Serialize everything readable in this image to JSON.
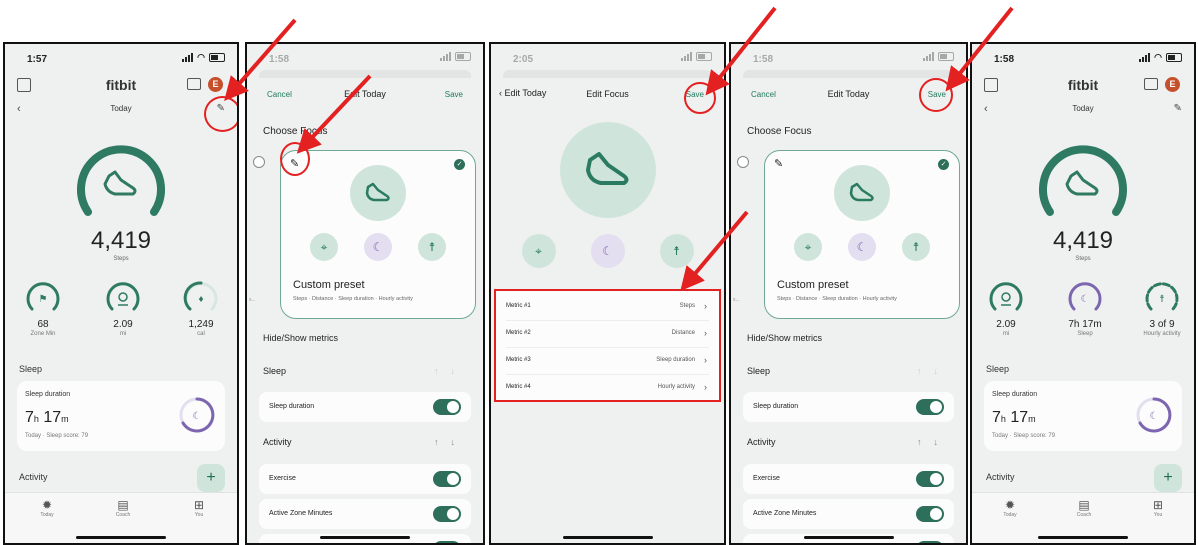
{
  "screen1": {
    "status_time": "1:57",
    "title": "fitbit",
    "avatar": "E",
    "nav_title": "Today",
    "main_value": "4,419",
    "main_label": "Steps",
    "minis": [
      {
        "value": "68",
        "label": "Zone Min"
      },
      {
        "value": "2.09",
        "label": "mi"
      },
      {
        "value": "1,249",
        "label": "cal"
      }
    ],
    "sleep_section": "Sleep",
    "sleep_card_title": "Sleep duration",
    "sleep_hours": "7",
    "sleep_h_unit": "h",
    "sleep_minutes": "17",
    "sleep_m_unit": "m",
    "sleep_sub": "Today · Sleep score: 79",
    "activity_section": "Activity",
    "add": "+",
    "bottom_nav": [
      "Today",
      "Coach",
      "You"
    ]
  },
  "screen2": {
    "status_time": "1:58",
    "cancel": "Cancel",
    "title": "Edit Today",
    "save": "Save",
    "choose_focus": "Choose Focus",
    "preset_name": "Custom preset",
    "preset_sub": "Steps · Distance · Sleep duration · Hourly activity",
    "peek": "s...",
    "hide_show": "Hide/Show metrics",
    "group_sleep": "Sleep",
    "row_sleep_duration": "Sleep duration",
    "group_activity": "Activity",
    "row_exercise": "Exercise",
    "row_azm": "Active Zone Minutes"
  },
  "screen3": {
    "status_time": "2:05",
    "back": "Edit Today",
    "title": "Edit Focus",
    "save": "Save",
    "metrics": [
      {
        "label": "Metric #1",
        "value": "Steps"
      },
      {
        "label": "Metric #2",
        "value": "Distance"
      },
      {
        "label": "Metric #3",
        "value": "Sleep duration"
      },
      {
        "label": "Metric #4",
        "value": "Hourly activity"
      }
    ]
  },
  "screen4": {
    "status_time": "1:58",
    "cancel": "Cancel",
    "title": "Edit Today",
    "save": "Save",
    "choose_focus": "Choose Focus",
    "preset_name": "Custom preset",
    "preset_sub": "Steps · Distance · Sleep duration · Hourly activity",
    "peek": "s...",
    "hide_show": "Hide/Show metrics",
    "group_sleep": "Sleep",
    "row_sleep_duration": "Sleep duration",
    "group_activity": "Activity",
    "row_exercise": "Exercise",
    "row_azm": "Active Zone Minutes"
  },
  "screen5": {
    "status_time": "1:58",
    "title": "fitbit",
    "avatar": "E",
    "nav_title": "Today",
    "main_value": "4,419",
    "main_label": "Steps",
    "minis": [
      {
        "value": "2.09",
        "label": "mi"
      },
      {
        "value": "7h 17m",
        "label": "Sleep"
      },
      {
        "value": "3 of 9",
        "label": "Hourly activity"
      }
    ],
    "sleep_section": "Sleep",
    "sleep_card_title": "Sleep duration",
    "sleep_hours": "7",
    "sleep_h_unit": "h",
    "sleep_minutes": "17",
    "sleep_m_unit": "m",
    "sleep_sub": "Today · Sleep score: 79",
    "activity_section": "Activity",
    "add": "+",
    "bottom_nav": [
      "Today",
      "Coach",
      "You"
    ]
  },
  "colors": {
    "accent_green": "#2d6f5a",
    "annotation_red": "#e32121",
    "sleep_purple": "#7d66b0"
  }
}
